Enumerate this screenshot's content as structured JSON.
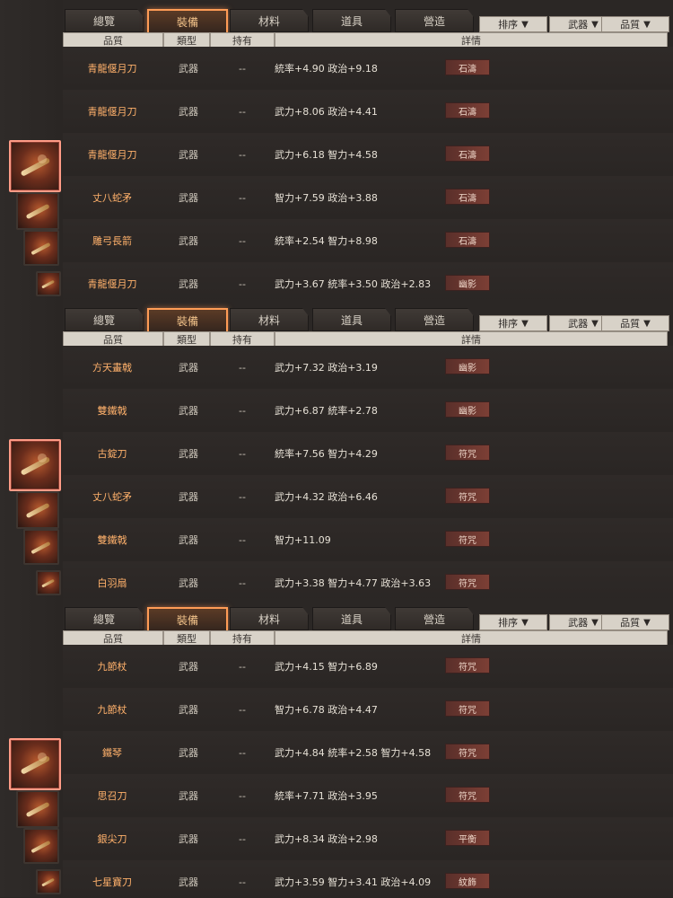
{
  "tabs": [
    "總覽",
    "裝備",
    "材料",
    "道具",
    "營造"
  ],
  "active_tab": "裝備",
  "filters": [
    {
      "label": "排序"
    },
    {
      "label": "武器"
    },
    {
      "label": "品質"
    }
  ],
  "headers": [
    "品質",
    "類型",
    "持有",
    "詳情"
  ],
  "panels": [
    {
      "rows": [
        {
          "name": "青龍偃月刀",
          "type": "武器",
          "own": "--",
          "detail": "統率+4.90  政治+9.18",
          "badge": "石濤"
        },
        {
          "name": "青龍偃月刀",
          "type": "武器",
          "own": "--",
          "detail": "武力+8.06  政治+4.41",
          "badge": "石濤"
        },
        {
          "name": "青龍偃月刀",
          "type": "武器",
          "own": "--",
          "detail": "武力+6.18  智力+4.58",
          "badge": "石濤"
        },
        {
          "name": "丈八蛇矛",
          "type": "武器",
          "own": "--",
          "detail": "智力+7.59  政治+3.88",
          "badge": "石濤"
        },
        {
          "name": "雕弓長箭",
          "type": "武器",
          "own": "--",
          "detail": "統率+2.54  智力+8.98",
          "badge": "石濤"
        },
        {
          "name": "青龍偃月刀",
          "type": "武器",
          "own": "--",
          "detail": "武力+3.67  統率+3.50  政治+2.83",
          "badge": "幽影"
        }
      ]
    },
    {
      "rows": [
        {
          "name": "方天畫戟",
          "type": "武器",
          "own": "--",
          "detail": "武力+7.32  政治+3.19",
          "badge": "幽影"
        },
        {
          "name": "雙鐵戟",
          "type": "武器",
          "own": "--",
          "detail": "武力+6.87  統率+2.78",
          "badge": "幽影"
        },
        {
          "name": "古錠刀",
          "type": "武器",
          "own": "--",
          "detail": "統率+7.56  智力+4.29",
          "badge": "符咒"
        },
        {
          "name": "丈八蛇矛",
          "type": "武器",
          "own": "--",
          "detail": "武力+4.32  政治+6.46",
          "badge": "符咒"
        },
        {
          "name": "雙鐵戟",
          "type": "武器",
          "own": "--",
          "detail": "智力+11.09",
          "badge": "符咒"
        },
        {
          "name": "白羽扇",
          "type": "武器",
          "own": "--",
          "detail": "武力+3.38  智力+4.77  政治+3.63",
          "badge": "符咒"
        }
      ]
    },
    {
      "rows": [
        {
          "name": "九節杖",
          "type": "武器",
          "own": "--",
          "detail": "武力+4.15  智力+6.89",
          "badge": "符咒"
        },
        {
          "name": "九節杖",
          "type": "武器",
          "own": "--",
          "detail": "智力+6.78  政治+4.47",
          "badge": "符咒"
        },
        {
          "name": "鐵琴",
          "type": "武器",
          "own": "--",
          "detail": "武力+4.84  統率+2.58  智力+4.58",
          "badge": "符咒"
        },
        {
          "name": "思召刀",
          "type": "武器",
          "own": "--",
          "detail": "統率+7.71  政治+3.95",
          "badge": "符咒"
        },
        {
          "name": "銀尖刀",
          "type": "武器",
          "own": "--",
          "detail": "武力+8.34  政治+2.98",
          "badge": "平衡"
        },
        {
          "name": "七星寶刀",
          "type": "武器",
          "own": "--",
          "detail": "武力+3.59  智力+3.41  政治+4.09",
          "badge": "紋飾"
        }
      ]
    }
  ]
}
